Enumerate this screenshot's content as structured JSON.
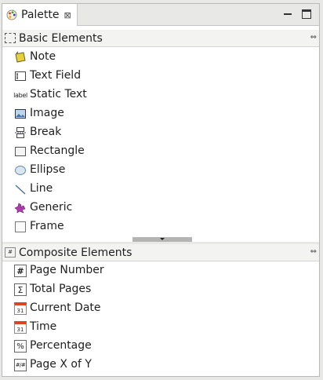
{
  "view": {
    "tab_title": "Palette",
    "close_glyph": "⊠",
    "tab_icon": "palette-icon",
    "minimize_icon": "minimize-icon",
    "maximize_icon": "maximize-icon"
  },
  "basic": {
    "title": "Basic Elements",
    "collapse_glyph": "⇔",
    "items": [
      {
        "label": "Note",
        "icon": "note-icon"
      },
      {
        "label": "Text Field",
        "icon": "text-field-icon"
      },
      {
        "label": "Static Text",
        "icon": "static-text-icon",
        "icon_text": "label"
      },
      {
        "label": "Image",
        "icon": "image-icon"
      },
      {
        "label": "Break",
        "icon": "break-icon"
      },
      {
        "label": "Rectangle",
        "icon": "rectangle-icon"
      },
      {
        "label": "Ellipse",
        "icon": "ellipse-icon"
      },
      {
        "label": "Line",
        "icon": "line-icon"
      },
      {
        "label": "Generic",
        "icon": "generic-icon"
      },
      {
        "label": "Frame",
        "icon": "frame-icon"
      }
    ]
  },
  "composite": {
    "title": "Composite Elements",
    "collapse_glyph": "⇔",
    "items": [
      {
        "label": "Page Number",
        "icon": "page-number-icon",
        "icon_text": "#"
      },
      {
        "label": "Total Pages",
        "icon": "total-pages-icon",
        "icon_text": "Σ"
      },
      {
        "label": "Current Date",
        "icon": "current-date-icon",
        "icon_text": "31"
      },
      {
        "label": "Time",
        "icon": "time-icon",
        "icon_text": "31"
      },
      {
        "label": "Percentage",
        "icon": "percentage-icon",
        "icon_text": "%"
      },
      {
        "label": "Page X of Y",
        "icon": "page-x-of-y-icon",
        "icon_text": "#/#"
      }
    ]
  }
}
